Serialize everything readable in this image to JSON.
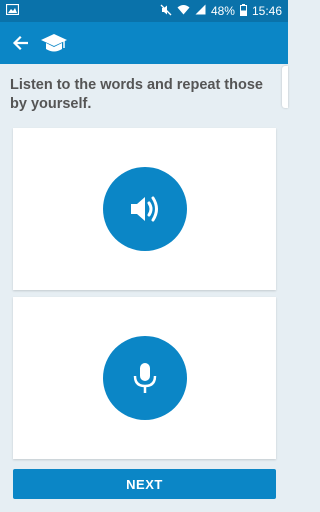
{
  "status_bar": {
    "battery": "48%",
    "time": "15:46",
    "icons": [
      "image-icon",
      "mute-icon",
      "wifi-icon",
      "signal-icon",
      "battery-icon"
    ]
  },
  "app_bar": {
    "icons": [
      "back-arrow-icon",
      "graduation-cap-icon"
    ]
  },
  "instruction": "Listen to the words and repeat those by yourself.",
  "cards": {
    "listen_icon": "speaker-icon",
    "record_icon": "microphone-icon"
  },
  "next_label": "NEXT",
  "colors": {
    "primary": "#0b86c6",
    "status_bar": "#0a72aa",
    "background": "#e6eef3",
    "text": "#555555"
  }
}
